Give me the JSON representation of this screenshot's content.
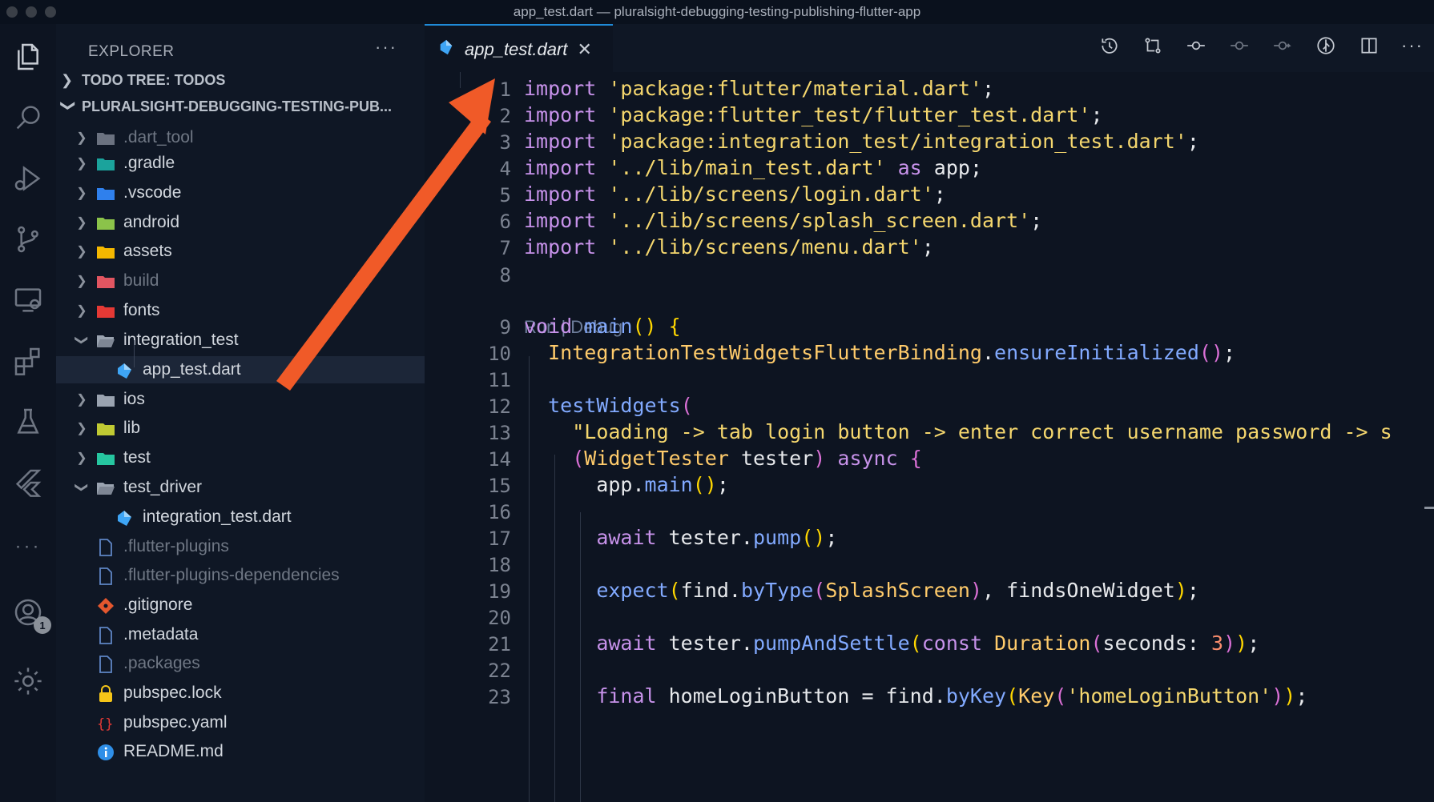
{
  "window": {
    "title": "app_test.dart — pluralsight-debugging-testing-publishing-flutter-app"
  },
  "activity_bar": {
    "icons": [
      "files-icon",
      "search-icon",
      "run-debug-icon",
      "source-control-icon",
      "remote-explorer-icon",
      "extensions-icon",
      "testing-icon",
      "flutter-icon",
      "more-icon",
      "account-icon",
      "settings-gear-icon"
    ],
    "account_badge": "1"
  },
  "sidebar": {
    "header": "EXPLORER",
    "more": "···",
    "todo_section": "TODO TREE: TODOS",
    "project_section": "PLURALSIGHT-DEBUGGING-TESTING-PUB...",
    "items": [
      {
        "label": ".dart_tool",
        "kind": "folder",
        "icon_color": "#6b7280",
        "dim": true
      },
      {
        "label": ".gradle",
        "kind": "folder",
        "icon_color": "#1ba39c",
        "dim": false
      },
      {
        "label": ".vscode",
        "kind": "folder",
        "icon_color": "#2f80ed",
        "dim": false
      },
      {
        "label": "android",
        "kind": "folder",
        "icon_color": "#8bc34a",
        "dim": false
      },
      {
        "label": "assets",
        "kind": "folder",
        "icon_color": "#f5b800",
        "dim": false
      },
      {
        "label": "build",
        "kind": "folder",
        "icon_color": "#e25561",
        "dim": true
      },
      {
        "label": "fonts",
        "kind": "folder",
        "icon_color": "#e53935",
        "dim": false
      },
      {
        "label": "integration_test",
        "kind": "folder-open",
        "icon_color": "#9aa3b0",
        "dim": false
      },
      {
        "label": "app_test.dart",
        "kind": "dart",
        "icon_color": "#3ea5f5",
        "dim": false
      },
      {
        "label": "ios",
        "kind": "folder",
        "icon_color": "#9aa3b0",
        "dim": false
      },
      {
        "label": "lib",
        "kind": "folder",
        "icon_color": "#c0ca33",
        "dim": false
      },
      {
        "label": "test",
        "kind": "folder",
        "icon_color": "#26c6a0",
        "dim": false
      },
      {
        "label": "test_driver",
        "kind": "folder-open",
        "icon_color": "#9aa3b0",
        "dim": false
      },
      {
        "label": "integration_test.dart",
        "kind": "dart",
        "icon_color": "#3ea5f5",
        "dim": false
      },
      {
        "label": ".flutter-plugins",
        "kind": "file",
        "icon_color": "#5f86c5",
        "dim": true
      },
      {
        "label": ".flutter-plugins-dependencies",
        "kind": "file",
        "icon_color": "#5f86c5",
        "dim": true
      },
      {
        "label": ".gitignore",
        "kind": "git",
        "icon_color": "#e4572e",
        "dim": false
      },
      {
        "label": ".metadata",
        "kind": "file",
        "icon_color": "#5f86c5",
        "dim": false
      },
      {
        "label": ".packages",
        "kind": "file",
        "icon_color": "#5f86c5",
        "dim": true
      },
      {
        "label": "pubspec.lock",
        "kind": "lock",
        "icon_color": "#f5c518",
        "dim": false
      },
      {
        "label": "pubspec.yaml",
        "kind": "yaml",
        "icon_color": "#e53935",
        "dim": false
      },
      {
        "label": "README.md",
        "kind": "info",
        "icon_color": "#2f8fe8",
        "dim": false
      }
    ]
  },
  "tabs": [
    {
      "label": "app_test.dart",
      "close": "✕"
    }
  ],
  "toolbar": [
    "history-icon",
    "compare-changes-icon",
    "git-commit-icon",
    "previous-change-icon",
    "next-change-icon",
    "flutter-outline-icon",
    "split-editor-icon",
    "more-actions-icon"
  ],
  "editor": {
    "codelens": "Run | Debug",
    "line_numbers": [
      "1",
      "2",
      "3",
      "4",
      "5",
      "6",
      "7",
      "8",
      "9",
      "10",
      "11",
      "12",
      "13",
      "14",
      "15",
      "16",
      "17",
      "18",
      "19",
      "20",
      "21",
      "22",
      "23"
    ],
    "lines": [
      [
        [
          "kw",
          "import"
        ],
        [
          "pl",
          " "
        ],
        [
          "str",
          "'package:flutter/material.dart'"
        ],
        [
          "pl",
          ";"
        ]
      ],
      [
        [
          "kw",
          "import"
        ],
        [
          "pl",
          " "
        ],
        [
          "str",
          "'package:flutter_test/flutter_test.dart'"
        ],
        [
          "pl",
          ";"
        ]
      ],
      [
        [
          "kw",
          "import"
        ],
        [
          "pl",
          " "
        ],
        [
          "str",
          "'package:integration_test/integration_test.dart'"
        ],
        [
          "pl",
          ";"
        ]
      ],
      [
        [
          "kw",
          "import"
        ],
        [
          "pl",
          " "
        ],
        [
          "str",
          "'../lib/main_test.dart'"
        ],
        [
          "pl",
          " "
        ],
        [
          "kw",
          "as"
        ],
        [
          "pl",
          " app;"
        ]
      ],
      [
        [
          "kw",
          "import"
        ],
        [
          "pl",
          " "
        ],
        [
          "str",
          "'../lib/screens/login.dart'"
        ],
        [
          "pl",
          ";"
        ]
      ],
      [
        [
          "kw",
          "import"
        ],
        [
          "pl",
          " "
        ],
        [
          "str",
          "'../lib/screens/splash_screen.dart'"
        ],
        [
          "pl",
          ";"
        ]
      ],
      [
        [
          "kw",
          "import"
        ],
        [
          "pl",
          " "
        ],
        [
          "str",
          "'../lib/screens/menu.dart'"
        ],
        [
          "pl",
          ";"
        ]
      ],
      [],
      [
        [
          "kw",
          "void"
        ],
        [
          "pl",
          " "
        ],
        [
          "fn",
          "main"
        ],
        [
          "paren1",
          "()"
        ],
        [
          "pl",
          " "
        ],
        [
          "paren1",
          "{"
        ]
      ],
      [
        [
          "pl",
          "  "
        ],
        [
          "cls",
          "IntegrationTestWidgetsFlutterBinding"
        ],
        [
          "pl",
          "."
        ],
        [
          "fn",
          "ensureInitialized"
        ],
        [
          "paren2",
          "()"
        ],
        [
          "pl",
          ";"
        ]
      ],
      [],
      [
        [
          "pl",
          "  "
        ],
        [
          "fn",
          "testWidgets"
        ],
        [
          "paren2",
          "("
        ]
      ],
      [
        [
          "pl",
          "    "
        ],
        [
          "str",
          "\"Loading -> tab login button -> enter correct username password -> s"
        ]
      ],
      [
        [
          "pl",
          "    "
        ],
        [
          "paren2",
          "("
        ],
        [
          "cls",
          "WidgetTester"
        ],
        [
          "pl",
          " tester"
        ],
        [
          "paren2",
          ")"
        ],
        [
          "pl",
          " "
        ],
        [
          "kw",
          "async"
        ],
        [
          "pl",
          " "
        ],
        [
          "paren2",
          "{"
        ]
      ],
      [
        [
          "pl",
          "      app."
        ],
        [
          "fn",
          "main"
        ],
        [
          "paren1",
          "()"
        ],
        [
          "pl",
          ";"
        ]
      ],
      [],
      [
        [
          "pl",
          "      "
        ],
        [
          "kw",
          "await"
        ],
        [
          "pl",
          " tester."
        ],
        [
          "fn",
          "pump"
        ],
        [
          "paren1",
          "()"
        ],
        [
          "pl",
          ";"
        ]
      ],
      [],
      [
        [
          "pl",
          "      "
        ],
        [
          "fn",
          "expect"
        ],
        [
          "paren1",
          "("
        ],
        [
          "pl",
          "find."
        ],
        [
          "fn",
          "byType"
        ],
        [
          "paren2",
          "("
        ],
        [
          "cls",
          "SplashScreen"
        ],
        [
          "paren2",
          ")"
        ],
        [
          "pl",
          ", findsOneWidget"
        ],
        [
          "paren1",
          ")"
        ],
        [
          "pl",
          ";"
        ]
      ],
      [],
      [
        [
          "pl",
          "      "
        ],
        [
          "kw",
          "await"
        ],
        [
          "pl",
          " tester."
        ],
        [
          "fn",
          "pumpAndSettle"
        ],
        [
          "paren1",
          "("
        ],
        [
          "kw",
          "const"
        ],
        [
          "pl",
          " "
        ],
        [
          "cls",
          "Duration"
        ],
        [
          "paren2",
          "("
        ],
        [
          "pl",
          "seconds: "
        ],
        [
          "num",
          "3"
        ],
        [
          "paren2",
          ")"
        ],
        [
          "paren1",
          ")"
        ],
        [
          "pl",
          ";"
        ]
      ],
      [],
      [
        [
          "pl",
          "      "
        ],
        [
          "kw",
          "final"
        ],
        [
          "pl",
          " homeLoginButton = find."
        ],
        [
          "fn",
          "byKey"
        ],
        [
          "paren1",
          "("
        ],
        [
          "cls",
          "Key"
        ],
        [
          "paren2",
          "("
        ],
        [
          "str",
          "'homeLoginButton'"
        ],
        [
          "paren2",
          ")"
        ],
        [
          "paren1",
          ")"
        ],
        [
          "pl",
          ";"
        ]
      ]
    ]
  }
}
